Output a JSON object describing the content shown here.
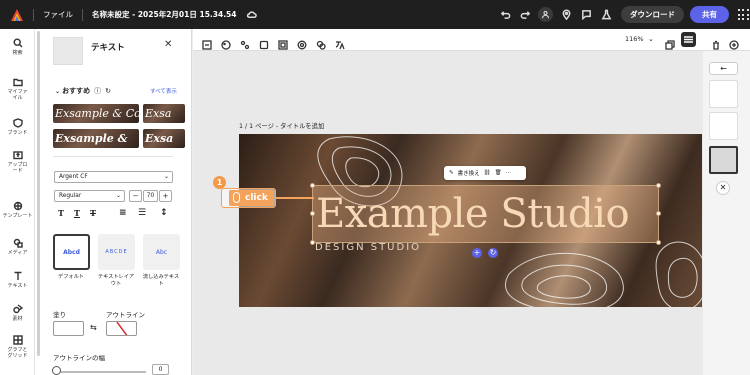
{
  "topbar": {
    "file_menu": "ファイル",
    "doc_title": "名称未設定 - 2025年2月01日 15.34.54",
    "download_label": "ダウンロード",
    "share_label": "共有"
  },
  "rail": {
    "items": [
      {
        "label": "検索",
        "icon": "search-icon"
      },
      {
        "label": "マイファイル",
        "icon": "folder-icon"
      },
      {
        "label": "ブランド",
        "icon": "brand-icon"
      },
      {
        "label": "アップロード",
        "icon": "upload-icon"
      },
      {
        "label": "テンプレート",
        "icon": "template-icon"
      },
      {
        "label": "メディア",
        "icon": "media-icon"
      },
      {
        "label": "テキスト",
        "icon": "text-icon"
      },
      {
        "label": "素材",
        "icon": "elements-icon"
      },
      {
        "label": "グラフとグリッド",
        "icon": "grid-icon"
      }
    ]
  },
  "panel": {
    "title": "テキスト",
    "recommended": "おすすめ",
    "show_all": "すべて表示",
    "tiles": [
      "Exsample & Co",
      "Exsa",
      "Exsample &",
      "Exsa"
    ],
    "font_name": "Argent CF",
    "font_weight": "Regular",
    "font_size": "70",
    "format_cards": [
      {
        "label": "デフォルト",
        "preview": "Abcd"
      },
      {
        "label": "テキストレイアウト",
        "preview": "ABCDE"
      },
      {
        "label": "流し込みテキスト",
        "preview": "Abc"
      }
    ],
    "fill_label": "塗り",
    "outline_label": "アウトライン",
    "outline_width_label": "アウトラインの幅",
    "outline_width_value": "0"
  },
  "toolbar": {
    "zoom": "116%"
  },
  "canvas": {
    "page_label": "1 / 1 ページ - タイトルを追加",
    "headline": "Example Studio",
    "subheadline": "DESIGN STUDIO",
    "float_replace": "書き換え",
    "callout_number": "1",
    "callout_text": "click"
  },
  "colors": {
    "accent": "#5c63e8",
    "callout": "#f3a35c",
    "headline": "#f8d9b7"
  }
}
